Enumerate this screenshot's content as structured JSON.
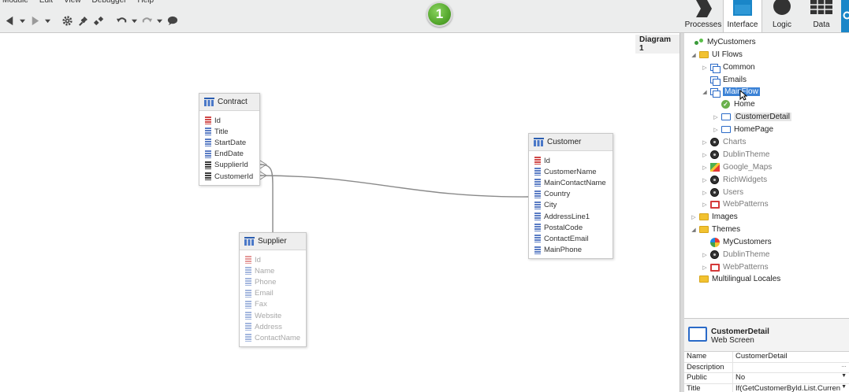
{
  "menu": [
    "Module",
    "Edit",
    "View",
    "Debugger",
    "Help"
  ],
  "toolbar": {
    "step_number": "1",
    "buttons": [
      "back-arrow-icon",
      "dropdown-icon",
      "forward-arrow-icon",
      "dropdown-icon",
      "gear-icon",
      "plug-icon",
      "plug-pair-icon",
      "undo-icon",
      "dropdown-icon",
      "redo-icon",
      "dropdown-icon",
      "comment-icon"
    ]
  },
  "modes": [
    {
      "label": "Processes",
      "icon": "processes-chevron-icon"
    },
    {
      "label": "Interface",
      "icon": "interface-window-icon"
    },
    {
      "label": "Logic",
      "icon": "logic-circle-icon"
    },
    {
      "label": "Data",
      "icon": "data-grid-icon"
    }
  ],
  "diagram": {
    "tab_label": "Diagram 1",
    "entities": {
      "contract": {
        "name": "Contract",
        "attributes": [
          {
            "name": "Id",
            "kind": "key"
          },
          {
            "name": "Title",
            "kind": "attr"
          },
          {
            "name": "StartDate",
            "kind": "attr"
          },
          {
            "name": "EndDate",
            "kind": "attr"
          },
          {
            "name": "SupplierId",
            "kind": "fk"
          },
          {
            "name": "CustomerId",
            "kind": "fk"
          }
        ]
      },
      "customer": {
        "name": "Customer",
        "attributes": [
          {
            "name": "Id",
            "kind": "key"
          },
          {
            "name": "CustomerName",
            "kind": "attr"
          },
          {
            "name": "MainContactName",
            "kind": "attr"
          },
          {
            "name": "Country",
            "kind": "attr"
          },
          {
            "name": "City",
            "kind": "attr"
          },
          {
            "name": "AddressLine1",
            "kind": "attr"
          },
          {
            "name": "PostalCode",
            "kind": "attr"
          },
          {
            "name": "ContactEmail",
            "kind": "attr"
          },
          {
            "name": "MainPhone",
            "kind": "attr"
          }
        ]
      },
      "supplier": {
        "name": "Supplier",
        "attributes": [
          {
            "name": "Id",
            "kind": "key"
          },
          {
            "name": "Name",
            "kind": "attr"
          },
          {
            "name": "Phone",
            "kind": "attr"
          },
          {
            "name": "Email",
            "kind": "attr"
          },
          {
            "name": "Fax",
            "kind": "attr"
          },
          {
            "name": "Website",
            "kind": "attr"
          },
          {
            "name": "Address",
            "kind": "attr"
          },
          {
            "name": "ContactName",
            "kind": "attr"
          }
        ]
      }
    }
  },
  "tree": {
    "root": "MyCustomers",
    "ui_flows": "UI Flows",
    "common": "Common",
    "emails": "Emails",
    "mainflow": "MainFlow",
    "home": "Home",
    "customer_detail": "CustomerDetail",
    "homepage": "HomePage",
    "charts": "Charts",
    "dublin_theme": "DublinTheme",
    "google_maps": "Google_Maps",
    "rich_widgets": "RichWidgets",
    "users": "Users",
    "web_patterns": "WebPatterns",
    "images": "Images",
    "themes": "Themes",
    "themes_mycustomers": "MyCustomers",
    "themes_dublin": "DublinTheme",
    "themes_webpatterns": "WebPatterns",
    "multilingual": "Multilingual Locales"
  },
  "properties": {
    "title": "CustomerDetail",
    "subtitle": "Web Screen",
    "rows": [
      {
        "key": "Name",
        "value": "CustomerDetail"
      },
      {
        "key": "Description",
        "value": ""
      },
      {
        "key": "Public",
        "value": "No"
      },
      {
        "key": "Title",
        "value": "If(GetCustomerById.List.Curren"
      }
    ]
  }
}
